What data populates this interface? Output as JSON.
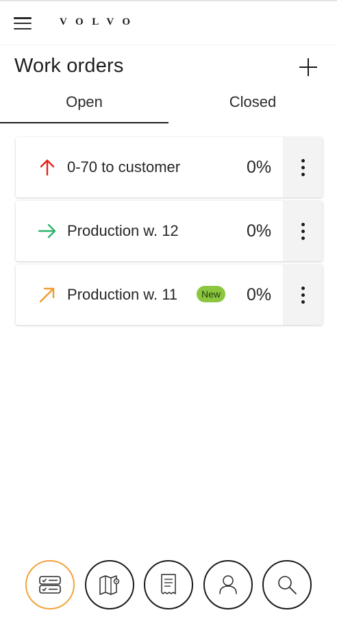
{
  "header": {
    "menu_icon": "hamburger-menu-icon",
    "brand": "VOLVO"
  },
  "page": {
    "title": "Work orders",
    "add_icon": "plus-icon"
  },
  "tabs": [
    {
      "label": "Open",
      "active": true
    },
    {
      "label": "Closed",
      "active": false
    }
  ],
  "work_orders": [
    {
      "title": "0-70 to customer",
      "progress": "0%",
      "arrow": "arrow-up-icon",
      "arrow_color": "#e2231a",
      "badge": ""
    },
    {
      "title": "Production w. 12",
      "progress": "0%",
      "arrow": "arrow-right-icon",
      "arrow_color": "#2db36a",
      "badge": ""
    },
    {
      "title": "Production w. 11",
      "progress": "0%",
      "arrow": "arrow-up-right-icon",
      "arrow_color": "#f29a2e",
      "badge": "New"
    }
  ],
  "bottom_nav": [
    {
      "icon": "work-orders-list-icon",
      "active": true
    },
    {
      "icon": "map-icon",
      "active": false
    },
    {
      "icon": "receipt-icon",
      "active": false
    },
    {
      "icon": "user-icon",
      "active": false
    },
    {
      "icon": "search-icon",
      "active": false
    }
  ],
  "colors": {
    "accent_orange": "#f3a33a",
    "badge_green": "#8cc63f"
  }
}
